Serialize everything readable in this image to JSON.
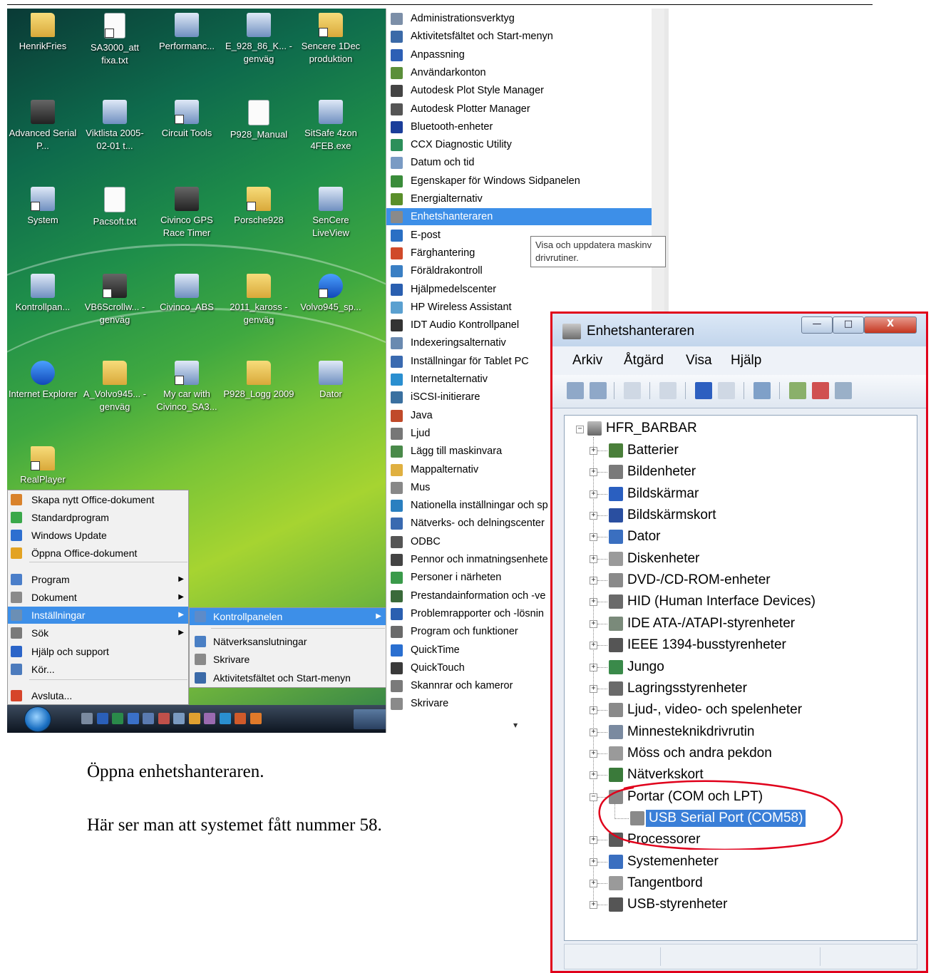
{
  "desktop": {
    "icons": [
      {
        "label": "HenrikFries",
        "kind": "folder"
      },
      {
        "label": "SA3000_att fixa.txt",
        "kind": "file"
      },
      {
        "label": "Performanc...",
        "kind": "app"
      },
      {
        "label": "E_928_86_K... - genväg",
        "kind": "app"
      },
      {
        "label": "Sencere 1Dec produktion",
        "kind": "folder"
      },
      {
        "label": "Advanced Serial P...",
        "kind": "dark"
      },
      {
        "label": "Viktlista 2005-02-01 t...",
        "kind": "app"
      },
      {
        "label": "Circuit Tools",
        "kind": "app"
      },
      {
        "label": "P928_Manual",
        "kind": "file"
      },
      {
        "label": "SitSafe 4zon 4FEB.exe",
        "kind": "app"
      },
      {
        "label": "System",
        "kind": "app"
      },
      {
        "label": "Pacsoft.txt",
        "kind": "file"
      },
      {
        "label": "Civinco GPS Race Timer",
        "kind": "dark"
      },
      {
        "label": "Porsche928",
        "kind": "folder"
      },
      {
        "label": "SenCere LiveView",
        "kind": "app"
      },
      {
        "label": "Kontrollpan...",
        "kind": "app"
      },
      {
        "label": "VB6Scrollw... - genväg",
        "kind": "dark"
      },
      {
        "label": "Civinco_ABS",
        "kind": "app"
      },
      {
        "label": "2011_kaross - genväg",
        "kind": "folder"
      },
      {
        "label": "Volvo945_sp...",
        "kind": "blue"
      },
      {
        "label": "Internet Explorer",
        "kind": "blue"
      },
      {
        "label": "A_Volvo945... - genväg",
        "kind": "folder"
      },
      {
        "label": "My car with Civinco_SA3...",
        "kind": "app"
      },
      {
        "label": "P928_Logg 2009",
        "kind": "folder"
      },
      {
        "label": "Dator",
        "kind": "app"
      },
      {
        "label": "RealPlayer",
        "kind": "folder"
      }
    ]
  },
  "start_menu": {
    "items": [
      {
        "label": "Skapa nytt Office-dokument",
        "submenu": false,
        "selected": false,
        "color": "#d9822b"
      },
      {
        "label": "Standardprogram",
        "submenu": false,
        "selected": false,
        "color": "#3aa84a"
      },
      {
        "label": "Windows Update",
        "submenu": false,
        "selected": false,
        "color": "#2d6fd0"
      },
      {
        "label": "Öppna Office-dokument",
        "submenu": false,
        "selected": false,
        "color": "#e3a323"
      },
      {
        "label": "Program",
        "submenu": true,
        "selected": false,
        "color": "#4a7ec9"
      },
      {
        "label": "Dokument",
        "submenu": true,
        "selected": false,
        "color": "#8a8a8a"
      },
      {
        "label": "Inställningar",
        "submenu": true,
        "selected": true,
        "color": "#6b8fb5"
      },
      {
        "label": "Sök",
        "submenu": true,
        "selected": false,
        "color": "#7a7a7a"
      },
      {
        "label": "Hjälp och support",
        "submenu": false,
        "selected": false,
        "color": "#2a64c8"
      },
      {
        "label": "Kör...",
        "submenu": false,
        "selected": false,
        "color": "#4c7bbd"
      },
      {
        "label": "Avsluta...",
        "submenu": false,
        "selected": false,
        "color": "#d6452a"
      }
    ]
  },
  "settings_submenu": {
    "items": [
      {
        "label": "Kontrollpanelen",
        "submenu": true,
        "selected": true,
        "color": "#5d8bc9"
      },
      {
        "label": "Nätverksanslutningar",
        "submenu": false,
        "selected": false,
        "color": "#4a7fc4"
      },
      {
        "label": "Skrivare",
        "submenu": false,
        "selected": false,
        "color": "#8a8a8a"
      },
      {
        "label": "Aktivitetsfältet och Start-menyn",
        "submenu": false,
        "selected": false,
        "color": "#3b6aa8"
      }
    ]
  },
  "control_panel": {
    "items": [
      {
        "label": "Administrationsverktyg",
        "color": "#7c8fa8",
        "selected": false
      },
      {
        "label": "Aktivitetsfältet och Start-menyn",
        "color": "#3b6aa8",
        "selected": false
      },
      {
        "label": "Anpassning",
        "color": "#2d5fb5",
        "selected": false
      },
      {
        "label": "Användarkonton",
        "color": "#5b8f3a",
        "selected": false
      },
      {
        "label": "Autodesk Plot Style Manager",
        "color": "#444444",
        "selected": false
      },
      {
        "label": "Autodesk Plotter Manager",
        "color": "#555555",
        "selected": false
      },
      {
        "label": "Bluetooth-enheter",
        "color": "#1b3e9a",
        "selected": false
      },
      {
        "label": "CCX Diagnostic Utility",
        "color": "#2c8f5a",
        "selected": false
      },
      {
        "label": "Datum och tid",
        "color": "#7a9bc4",
        "selected": false
      },
      {
        "label": "Egenskaper för Windows Sidpanelen",
        "color": "#3a8c3a",
        "selected": false
      },
      {
        "label": "Energialternativ",
        "color": "#5a8f2a",
        "selected": false
      },
      {
        "label": "Enhetshanteraren",
        "color": "#8a8a8a",
        "selected": true
      },
      {
        "label": "E-post",
        "color": "#2a6fc4",
        "selected": false
      },
      {
        "label": "Färghantering",
        "color": "#d04a2a",
        "selected": false
      },
      {
        "label": "Föräldrakontroll",
        "color": "#3a7fc4",
        "selected": false
      },
      {
        "label": "Hjälpmedelscenter",
        "color": "#2a5fb0",
        "selected": false
      },
      {
        "label": "HP Wireless Assistant",
        "color": "#5aa0d0",
        "selected": false
      },
      {
        "label": "IDT Audio  Kontrollpanel",
        "color": "#333333",
        "selected": false
      },
      {
        "label": "Indexeringsalternativ",
        "color": "#6a8ab0",
        "selected": false
      },
      {
        "label": "Inställningar för Tablet PC",
        "color": "#3a6ab0",
        "selected": false
      },
      {
        "label": "Internetalternativ",
        "color": "#2a8fd0",
        "selected": false
      },
      {
        "label": "iSCSI-initierare",
        "color": "#3a70a0",
        "selected": false
      },
      {
        "label": "Java",
        "color": "#c04a2a",
        "selected": false
      },
      {
        "label": "Ljud",
        "color": "#777777",
        "selected": false
      },
      {
        "label": "Lägg till maskinvara",
        "color": "#4a8a4a",
        "selected": false
      },
      {
        "label": "Mappalternativ",
        "color": "#e0b040",
        "selected": false
      },
      {
        "label": "Mus",
        "color": "#888888",
        "selected": false
      },
      {
        "label": "Nationella inställningar och sp",
        "color": "#2a7fc0",
        "selected": false
      },
      {
        "label": "Nätverks- och delningscenter",
        "color": "#3a6ab0",
        "selected": false
      },
      {
        "label": "ODBC",
        "color": "#555555",
        "selected": false
      },
      {
        "label": "Pennor och inmatningsenhete",
        "color": "#444444",
        "selected": false
      },
      {
        "label": "Personer i närheten",
        "color": "#3a9a4a",
        "selected": false
      },
      {
        "label": "Prestandainformation och -ve",
        "color": "#3a6a3a",
        "selected": false
      },
      {
        "label": "Problemrapporter och -lösnin",
        "color": "#2a5fb0",
        "selected": false
      },
      {
        "label": "Program och funktioner",
        "color": "#6a6a6a",
        "selected": false
      },
      {
        "label": "QuickTime",
        "color": "#2a6fd0",
        "selected": false
      },
      {
        "label": "QuickTouch",
        "color": "#3a3a3a",
        "selected": false
      },
      {
        "label": "Skannrar och kameror",
        "color": "#7a7a7a",
        "selected": false
      },
      {
        "label": "Skrivare",
        "color": "#8a8a8a",
        "selected": false
      }
    ]
  },
  "tooltip": {
    "line1": "Visa och uppdatera maskinv",
    "line2": "drivrutiner."
  },
  "device_manager": {
    "title": "Enhetshanteraren",
    "window_buttons": {
      "minimize": "—",
      "maximize": "□",
      "close": "X"
    },
    "menus": [
      "Arkiv",
      "Åtgärd",
      "Visa",
      "Hjälp"
    ],
    "root": "HFR_BARBAR",
    "categories": [
      {
        "label": "Batterier",
        "color": "#4a7f3a"
      },
      {
        "label": "Bildenheter",
        "color": "#7a7a7a"
      },
      {
        "label": "Bildskärmar",
        "color": "#2a5fc0"
      },
      {
        "label": "Bildskärmskort",
        "color": "#2a4fa0"
      },
      {
        "label": "Dator",
        "color": "#3a6fc0"
      },
      {
        "label": "Diskenheter",
        "color": "#9a9a9a"
      },
      {
        "label": "DVD-/CD-ROM-enheter",
        "color": "#8a8a8a"
      },
      {
        "label": "HID (Human Interface Devices)",
        "color": "#6a6a6a"
      },
      {
        "label": "IDE ATA-/ATAPI-styrenheter",
        "color": "#7a8a7a"
      },
      {
        "label": "IEEE 1394-busstyrenheter",
        "color": "#555555"
      },
      {
        "label": "Jungo",
        "color": "#3a8a4a"
      },
      {
        "label": "Lagringsstyrenheter",
        "color": "#6a6a6a"
      },
      {
        "label": "Ljud-, video- och spelenheter",
        "color": "#8a8a8a"
      },
      {
        "label": "Minnesteknikdrivrutin",
        "color": "#7a8aa0"
      },
      {
        "label": "Möss och andra pekdon",
        "color": "#9a9a9a"
      },
      {
        "label": "Nätverkskort",
        "color": "#3a7a3a"
      },
      {
        "label": "Portar (COM och LPT)",
        "color": "#8a8a8a",
        "expanded": true
      },
      {
        "label": "USB Serial Port (COM58)",
        "color": "#8a8a8a",
        "child": true,
        "selected": true
      },
      {
        "label": "Processorer",
        "color": "#5a5a5a"
      },
      {
        "label": "Systemenheter",
        "color": "#3a6fc0"
      },
      {
        "label": "Tangentbord",
        "color": "#9a9a9a"
      },
      {
        "label": "USB-styrenheter",
        "color": "#555555"
      }
    ]
  },
  "captions": {
    "line1": "Öppna enhetshanteraren.",
    "line2": "Här ser man att systemet fått nummer 58."
  }
}
